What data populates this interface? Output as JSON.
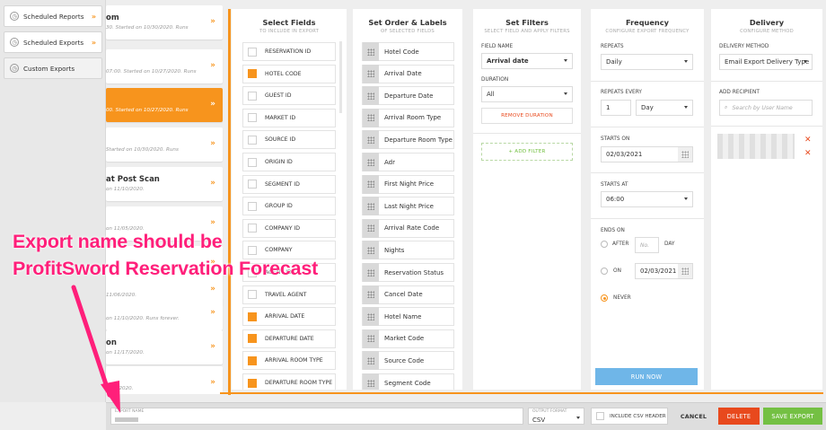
{
  "sidebar": {
    "items": [
      {
        "label": "Scheduled Reports",
        "icon": "clock-icon"
      },
      {
        "label": "Scheduled Exports",
        "icon": "clock-icon"
      },
      {
        "label": "Custom Exports",
        "icon": "clock-icon"
      }
    ]
  },
  "reports": [
    {
      "title": "om",
      "subtitle": "30. Started on 10/30/2020. Runs",
      "selected": false
    },
    {
      "title": "",
      "subtitle": "07:00. Started on 10/27/2020. Runs",
      "selected": false
    },
    {
      "title": "",
      "subtitle": "00. Started on 10/27/2020. Runs",
      "selected": true
    },
    {
      "title": "",
      "subtitle": "Started on 10/30/2020. Runs",
      "selected": false
    },
    {
      "title": "at Post Scan",
      "subtitle": "on 11/10/2020.",
      "selected": false
    },
    {
      "title": "",
      "subtitle": "on 11/05/2020.",
      "selected": false
    },
    {
      "title": "",
      "subtitle": "",
      "selected": false
    },
    {
      "title": "",
      "subtitle": "11/06/2020.",
      "selected": false
    },
    {
      "title": "",
      "subtitle": "on 11/10/2020. Runs forever.",
      "selected": false
    },
    {
      "title": "on",
      "subtitle": "on 11/17/2020.",
      "selected": false
    },
    {
      "title": "",
      "subtitle": "1/18/2020.",
      "selected": false
    }
  ],
  "select_fields": {
    "title": "Select Fields",
    "subtitle": "TO INCLUDE IN EXPORT",
    "fields": [
      {
        "label": "RESERVATION ID",
        "checked": false
      },
      {
        "label": "HOTEL CODE",
        "checked": true
      },
      {
        "label": "GUEST ID",
        "checked": false
      },
      {
        "label": "MARKET ID",
        "checked": false
      },
      {
        "label": "SOURCE ID",
        "checked": false
      },
      {
        "label": "ORIGIN ID",
        "checked": false
      },
      {
        "label": "SEGMENT ID",
        "checked": false
      },
      {
        "label": "GROUP ID",
        "checked": false
      },
      {
        "label": "COMPANY ID",
        "checked": false
      },
      {
        "label": "COMPANY",
        "checked": false
      },
      {
        "label": "AGENT ID",
        "checked": false
      },
      {
        "label": "TRAVEL AGENT",
        "checked": false
      },
      {
        "label": "ARRIVAL DATE",
        "checked": true
      },
      {
        "label": "DEPARTURE DATE",
        "checked": true
      },
      {
        "label": "ARRIVAL ROOM TYPE",
        "checked": true
      },
      {
        "label": "DEPARTURE ROOM TYPE",
        "checked": true
      }
    ]
  },
  "order_labels": {
    "title": "Set Order & Labels",
    "subtitle": "OF SELECTED FIELDS",
    "items": [
      "Hotel Code",
      "Arrival Date",
      "Departure Date",
      "Arrival Room Type",
      "Departure Room Type",
      "Adr",
      "First Night Price",
      "Last Night Price",
      "Arrival Rate Code",
      "Nights",
      "Reservation Status",
      "Cancel Date",
      "Hotel Name",
      "Market Code",
      "Source Code",
      "Segment Code"
    ]
  },
  "filters": {
    "title": "Set Filters",
    "subtitle": "SELECT FIELD AND APPLY FILTERS",
    "field_name_label": "FIELD NAME",
    "field_name_value": "Arrival date",
    "duration_label": "DURATION",
    "duration_value": "All",
    "remove_label": "REMOVE DURATION",
    "add_label": "+ ADD FILTER"
  },
  "frequency": {
    "title": "Frequency",
    "subtitle": "CONFIGURE EXPORT FREQUENCY",
    "repeats_label": "REPEATS",
    "repeats_value": "Daily",
    "repeats_every_label": "REPEATS EVERY",
    "repeats_every_value": "1",
    "repeats_every_unit": "Day",
    "starts_on_label": "STARTS ON",
    "starts_on_value": "02/03/2021",
    "starts_at_label": "STARTS AT",
    "starts_at_value": "06:00",
    "ends_on_label": "ENDS ON",
    "after_label": "AFTER",
    "after_placeholder": "No.",
    "day_label": "DAY",
    "on_label": "ON",
    "on_value": "02/03/2021",
    "never_label": "NEVER",
    "run_now_label": "RUN NOW"
  },
  "delivery": {
    "title": "Delivery",
    "subtitle": "CONFIGURE METHOD",
    "method_label": "DELIVERY METHOD",
    "method_value": "Email Export Delivery Type",
    "add_recipient_label": "ADD RECIPIENT",
    "search_placeholder": "Search by User Name"
  },
  "footer": {
    "export_name_label": "EXPORT NAME",
    "output_format_label": "OUTPUT FORMAT",
    "output_format_value": "CSV",
    "csv_header_label": "INCLUDE CSV HEADER",
    "cancel_label": "CANCEL",
    "delete_label": "DELETE",
    "save_label": "SAVE EXPORT"
  },
  "annotation": {
    "line1": "Export name should be",
    "line2": "ProfitSword Reservation Forecast"
  },
  "colors": {
    "accent": "#f7941d",
    "delete": "#e8491d",
    "save": "#74c043",
    "run_now": "#6fb6e8",
    "annotation": "#ff1f7a"
  }
}
